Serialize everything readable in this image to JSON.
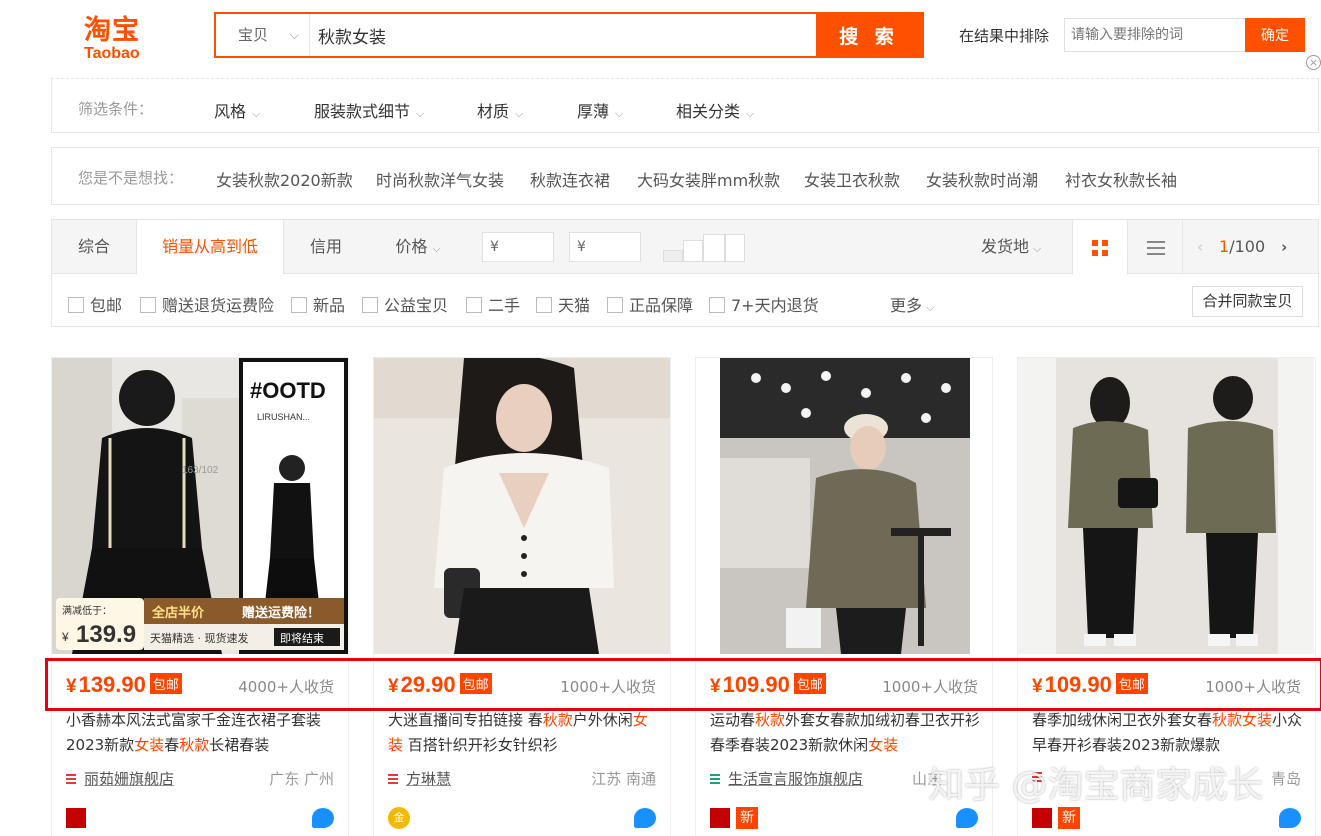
{
  "header": {
    "logo_cn": "淘宝",
    "logo_en": "Taobao",
    "search_type": "宝贝",
    "search_value": "秋款女装",
    "search_button": "搜 索",
    "exclude_label": "在结果中排除",
    "exclude_placeholder": "请输入要排除的词",
    "exclude_button": "确定",
    "close_glyph": "×"
  },
  "filters": {
    "label": "筛选条件：",
    "items": [
      "风格",
      "服装款式细节",
      "材质",
      "厚薄",
      "相关分类"
    ]
  },
  "suggestions": {
    "label": "您是不是想找：",
    "items": [
      "女装秋款2020新款",
      "时尚秋款洋气女装",
      "秋款连衣裙",
      "大码女装胖mm秋款",
      "女装卫衣秋款",
      "女装秋款时尚潮",
      "衬衣女秋款长袖"
    ]
  },
  "sort": {
    "tabs": [
      "综合",
      "销量从高到低",
      "信用",
      "价格"
    ],
    "active_tab": "销量从高到低",
    "price_min_placeholder": "¥",
    "price_dash": "-",
    "price_max_placeholder": "¥",
    "ship_from": "发货地",
    "page_current": "1",
    "page_total": "/100",
    "prev_glyph": "‹",
    "next_glyph": "›",
    "chevron_glyph": "⌵"
  },
  "checks": {
    "items": [
      "包邮",
      "赠送退货运费险",
      "新品",
      "公益宝贝",
      "二手",
      "天猫",
      "正品保障",
      "7+天内退货"
    ],
    "more": "更多",
    "merge_button": "合并同款宝贝"
  },
  "products": [
    {
      "price": "139.90",
      "currency": "¥",
      "free_ship": "包邮",
      "sales": "4000+人收货",
      "title_parts": [
        "小香赫本风法式富家千金连衣裙子套装2023新款",
        "女装",
        "春",
        "秋款",
        "长裙春装"
      ],
      "shop": "丽茹姗旗舰店",
      "location": "广东 广州",
      "badge_new": "",
      "img_text": {
        "ootd": "#OOTD",
        "brand": "LIRUSHAN...",
        "promo_label": "满减低于：",
        "promo_price": "139.9",
        "promo_yen": "¥",
        "promo_banner": "全店半价",
        "promo_gift": "赠送运费险！",
        "promo_sub": "天猫精选 · 现货速发",
        "promo_end": "即将结束",
        "size": "163/102"
      }
    },
    {
      "price": "29.90",
      "currency": "¥",
      "free_ship": "包邮",
      "sales": "1000+人收货",
      "title_parts": [
        "大迷直播间专拍链接 春",
        "秋款",
        "户外休闲",
        "女装",
        " 百搭针织开衫女针织衫"
      ],
      "shop": "方琳慧",
      "location": "江苏 南通",
      "badge_new": "",
      "badge_gold": "金"
    },
    {
      "price": "109.90",
      "currency": "¥",
      "free_ship": "包邮",
      "sales": "1000+人收货",
      "title_parts": [
        "运动春",
        "秋款",
        "外套女春款加绒初春卫衣开衫春季春装2023新款休闲",
        "女装"
      ],
      "shop": "生活宣言服饰旗舰店",
      "location": "山东",
      "badge_new": "新"
    },
    {
      "price": "109.90",
      "currency": "¥",
      "free_ship": "包邮",
      "sales": "1000+人收货",
      "title_parts": [
        "春季加绒休闲卫衣外套女春",
        "秋款女装",
        "小众早春开衫春装2023新款爆款"
      ],
      "shop": "",
      "location": "青岛",
      "badge_new": "新"
    }
  ],
  "watermark": "知乎 @淘宝商家成长",
  "colors": {
    "accent": "#ff5000",
    "price": "#ff4400",
    "highlight_box": "#e60012"
  }
}
